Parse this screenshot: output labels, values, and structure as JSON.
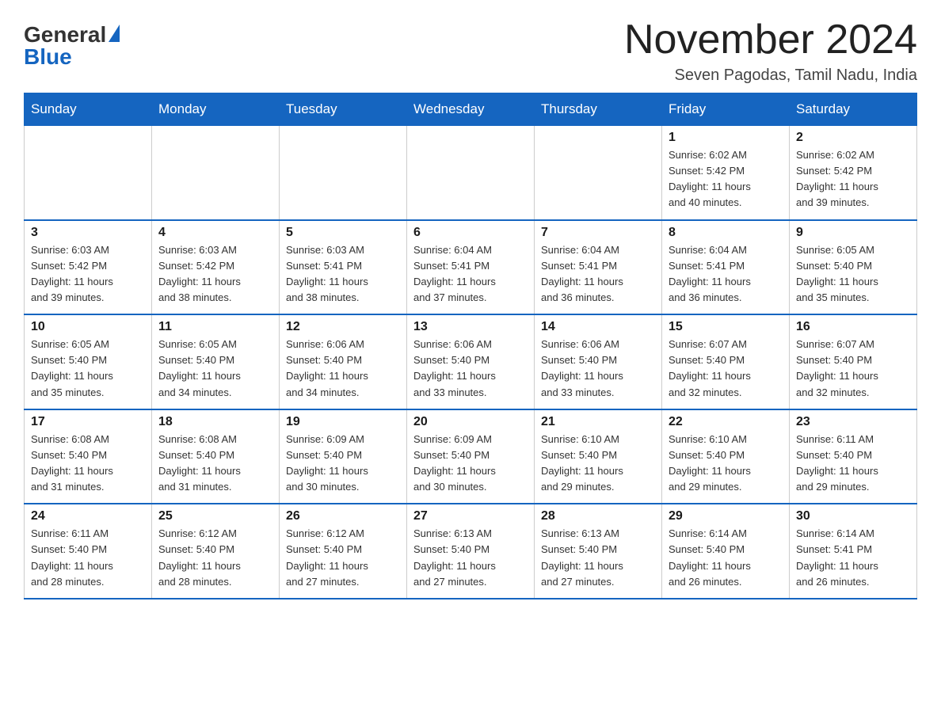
{
  "header": {
    "logo_general": "General",
    "logo_blue": "Blue",
    "month_title": "November 2024",
    "location": "Seven Pagodas, Tamil Nadu, India"
  },
  "weekdays": [
    "Sunday",
    "Monday",
    "Tuesday",
    "Wednesday",
    "Thursday",
    "Friday",
    "Saturday"
  ],
  "weeks": [
    [
      {
        "day": "",
        "info": ""
      },
      {
        "day": "",
        "info": ""
      },
      {
        "day": "",
        "info": ""
      },
      {
        "day": "",
        "info": ""
      },
      {
        "day": "",
        "info": ""
      },
      {
        "day": "1",
        "info": "Sunrise: 6:02 AM\nSunset: 5:42 PM\nDaylight: 11 hours\nand 40 minutes."
      },
      {
        "day": "2",
        "info": "Sunrise: 6:02 AM\nSunset: 5:42 PM\nDaylight: 11 hours\nand 39 minutes."
      }
    ],
    [
      {
        "day": "3",
        "info": "Sunrise: 6:03 AM\nSunset: 5:42 PM\nDaylight: 11 hours\nand 39 minutes."
      },
      {
        "day": "4",
        "info": "Sunrise: 6:03 AM\nSunset: 5:42 PM\nDaylight: 11 hours\nand 38 minutes."
      },
      {
        "day": "5",
        "info": "Sunrise: 6:03 AM\nSunset: 5:41 PM\nDaylight: 11 hours\nand 38 minutes."
      },
      {
        "day": "6",
        "info": "Sunrise: 6:04 AM\nSunset: 5:41 PM\nDaylight: 11 hours\nand 37 minutes."
      },
      {
        "day": "7",
        "info": "Sunrise: 6:04 AM\nSunset: 5:41 PM\nDaylight: 11 hours\nand 36 minutes."
      },
      {
        "day": "8",
        "info": "Sunrise: 6:04 AM\nSunset: 5:41 PM\nDaylight: 11 hours\nand 36 minutes."
      },
      {
        "day": "9",
        "info": "Sunrise: 6:05 AM\nSunset: 5:40 PM\nDaylight: 11 hours\nand 35 minutes."
      }
    ],
    [
      {
        "day": "10",
        "info": "Sunrise: 6:05 AM\nSunset: 5:40 PM\nDaylight: 11 hours\nand 35 minutes."
      },
      {
        "day": "11",
        "info": "Sunrise: 6:05 AM\nSunset: 5:40 PM\nDaylight: 11 hours\nand 34 minutes."
      },
      {
        "day": "12",
        "info": "Sunrise: 6:06 AM\nSunset: 5:40 PM\nDaylight: 11 hours\nand 34 minutes."
      },
      {
        "day": "13",
        "info": "Sunrise: 6:06 AM\nSunset: 5:40 PM\nDaylight: 11 hours\nand 33 minutes."
      },
      {
        "day": "14",
        "info": "Sunrise: 6:06 AM\nSunset: 5:40 PM\nDaylight: 11 hours\nand 33 minutes."
      },
      {
        "day": "15",
        "info": "Sunrise: 6:07 AM\nSunset: 5:40 PM\nDaylight: 11 hours\nand 32 minutes."
      },
      {
        "day": "16",
        "info": "Sunrise: 6:07 AM\nSunset: 5:40 PM\nDaylight: 11 hours\nand 32 minutes."
      }
    ],
    [
      {
        "day": "17",
        "info": "Sunrise: 6:08 AM\nSunset: 5:40 PM\nDaylight: 11 hours\nand 31 minutes."
      },
      {
        "day": "18",
        "info": "Sunrise: 6:08 AM\nSunset: 5:40 PM\nDaylight: 11 hours\nand 31 minutes."
      },
      {
        "day": "19",
        "info": "Sunrise: 6:09 AM\nSunset: 5:40 PM\nDaylight: 11 hours\nand 30 minutes."
      },
      {
        "day": "20",
        "info": "Sunrise: 6:09 AM\nSunset: 5:40 PM\nDaylight: 11 hours\nand 30 minutes."
      },
      {
        "day": "21",
        "info": "Sunrise: 6:10 AM\nSunset: 5:40 PM\nDaylight: 11 hours\nand 29 minutes."
      },
      {
        "day": "22",
        "info": "Sunrise: 6:10 AM\nSunset: 5:40 PM\nDaylight: 11 hours\nand 29 minutes."
      },
      {
        "day": "23",
        "info": "Sunrise: 6:11 AM\nSunset: 5:40 PM\nDaylight: 11 hours\nand 29 minutes."
      }
    ],
    [
      {
        "day": "24",
        "info": "Sunrise: 6:11 AM\nSunset: 5:40 PM\nDaylight: 11 hours\nand 28 minutes."
      },
      {
        "day": "25",
        "info": "Sunrise: 6:12 AM\nSunset: 5:40 PM\nDaylight: 11 hours\nand 28 minutes."
      },
      {
        "day": "26",
        "info": "Sunrise: 6:12 AM\nSunset: 5:40 PM\nDaylight: 11 hours\nand 27 minutes."
      },
      {
        "day": "27",
        "info": "Sunrise: 6:13 AM\nSunset: 5:40 PM\nDaylight: 11 hours\nand 27 minutes."
      },
      {
        "day": "28",
        "info": "Sunrise: 6:13 AM\nSunset: 5:40 PM\nDaylight: 11 hours\nand 27 minutes."
      },
      {
        "day": "29",
        "info": "Sunrise: 6:14 AM\nSunset: 5:40 PM\nDaylight: 11 hours\nand 26 minutes."
      },
      {
        "day": "30",
        "info": "Sunrise: 6:14 AM\nSunset: 5:41 PM\nDaylight: 11 hours\nand 26 minutes."
      }
    ]
  ]
}
